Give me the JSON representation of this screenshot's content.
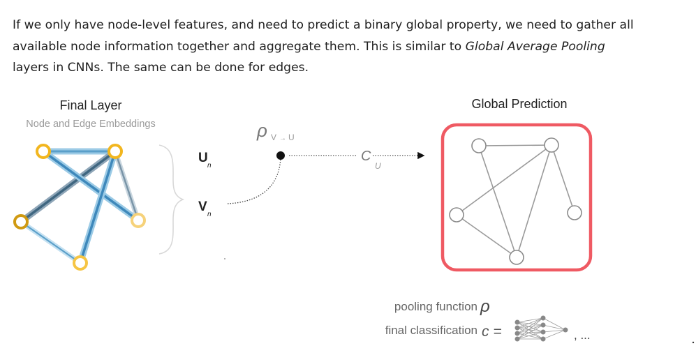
{
  "intro": {
    "part1": "If we only have node-level features, and need to predict a binary global property, we need to gather all available node information together and aggregate them. This is similar to ",
    "italic": "Global Average Pooling",
    "part2": " layers in CNNs. The same can be done for edges."
  },
  "diagram": {
    "final_layer_title": "Final Layer",
    "final_layer_subtitle": "Node and Edge Embeddings",
    "u_label": "U",
    "v_label": "V",
    "subscript_n": "n",
    "rho_symbol": "ρ",
    "rho_subscript": "V",
    "rho_arrow": "→",
    "rho_u": "U",
    "c_symbol": "C",
    "global_prediction_title": "Global Prediction",
    "legend_pooling": "pooling function",
    "legend_classification": "final classification",
    "legend_c_eq": "c =",
    "ellipsis": ", ...",
    "colors": {
      "accent_red": "#ef5a63",
      "node_yellow": "#f6c544",
      "node_dark_yellow": "#d9a21a",
      "edge_blue": "#6aaed6",
      "edge_dark": "#4d6e86",
      "graph_gray": "#8a8a8a"
    }
  }
}
